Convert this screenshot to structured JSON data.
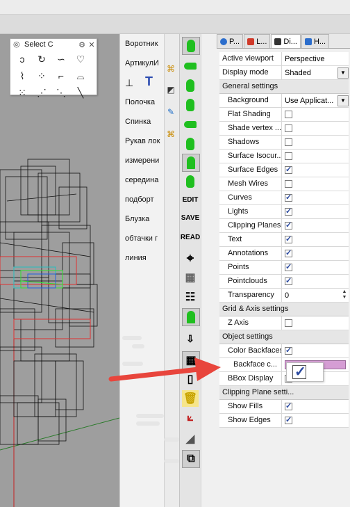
{
  "select_panel": {
    "title": "Select C",
    "icons": [
      "spiral-icon",
      "spiral2-icon",
      "curve-icon",
      "blob-icon",
      "scribble-icon",
      "dots-icon",
      "corner-icon",
      "shape-icon",
      "points-icon",
      "segment-icon",
      "dashed-segment-icon",
      "line-icon"
    ]
  },
  "patterns": {
    "items": [
      "Воротник",
      "АртикулИ",
      "Полочка",
      "Спинка",
      "Рукав лок",
      "измерени",
      "середина",
      "подборт",
      "Блузка",
      "обтачки г",
      "линия"
    ]
  },
  "toolbar": {
    "buttons": [
      "shoe-icon",
      "sole-icon",
      "shoe-side-icon",
      "shoe-tall-icon",
      "shoe-flat-icon",
      "boot-icon",
      "cone-icon",
      "heel-icon",
      "EDIT",
      "SAVE",
      "READ",
      "target-icon",
      "grid-icon",
      "list-icon",
      "cone2-icon",
      "download-icon",
      "grid2-icon",
      "page-icon",
      "trash-icon",
      "axes-icon",
      "slope-icon",
      "stack-icon"
    ]
  },
  "props": {
    "tabs": [
      {
        "label": "P...",
        "icon": "properties-icon"
      },
      {
        "label": "L...",
        "icon": "layers-icon"
      },
      {
        "label": "Di...",
        "icon": "display-icon"
      },
      {
        "label": "H...",
        "icon": "help-icon"
      }
    ],
    "active_viewport": {
      "label": "Active viewport",
      "value": "Perspective"
    },
    "display_mode": {
      "label": "Display mode",
      "value": "Shaded"
    },
    "general": {
      "title": "General settings",
      "background": {
        "label": "Background",
        "value": "Use Applicat..."
      },
      "flat_shading": {
        "label": "Flat Shading",
        "checked": false
      },
      "shade_vertex": {
        "label": "Shade vertex ...",
        "checked": false
      },
      "shadows": {
        "label": "Shadows",
        "checked": false
      },
      "surface_isocurves": {
        "label": "Surface Isocur...",
        "checked": false
      },
      "surface_edges": {
        "label": "Surface Edges",
        "checked": true
      },
      "mesh_wires": {
        "label": "Mesh Wires",
        "checked": false
      },
      "curves": {
        "label": "Curves",
        "checked": true
      },
      "lights": {
        "label": "Lights",
        "checked": true
      },
      "clipping_planes": {
        "label": "Clipping Planes",
        "checked": true
      },
      "text": {
        "label": "Text",
        "checked": true
      },
      "annotations": {
        "label": "Annotations",
        "checked": true
      },
      "points": {
        "label": "Points",
        "checked": true
      },
      "pointclouds": {
        "label": "Pointclouds",
        "checked": true
      },
      "transparency": {
        "label": "Transparency",
        "value": "0"
      }
    },
    "grid_axis": {
      "title": "Grid & Axis settings",
      "z_axis": {
        "label": "Z Axis",
        "checked": false
      }
    },
    "object": {
      "title": "Object settings",
      "color_backfaces": {
        "label": "Color Backfaces",
        "checked": true
      },
      "backface_color": {
        "label": "Backface c...",
        "color": "#d59dd4"
      },
      "bbox_display": {
        "label": "BBox Display",
        "checked": true
      }
    },
    "clipping": {
      "title": "Clipping Plane setti...",
      "show_fills": {
        "label": "Show Fills",
        "checked": true
      },
      "show_edges": {
        "label": "Show Edges",
        "checked": true
      }
    }
  },
  "colors": {
    "accent_arrow": "#e8453c",
    "green_icon": "#1fbf1f"
  }
}
